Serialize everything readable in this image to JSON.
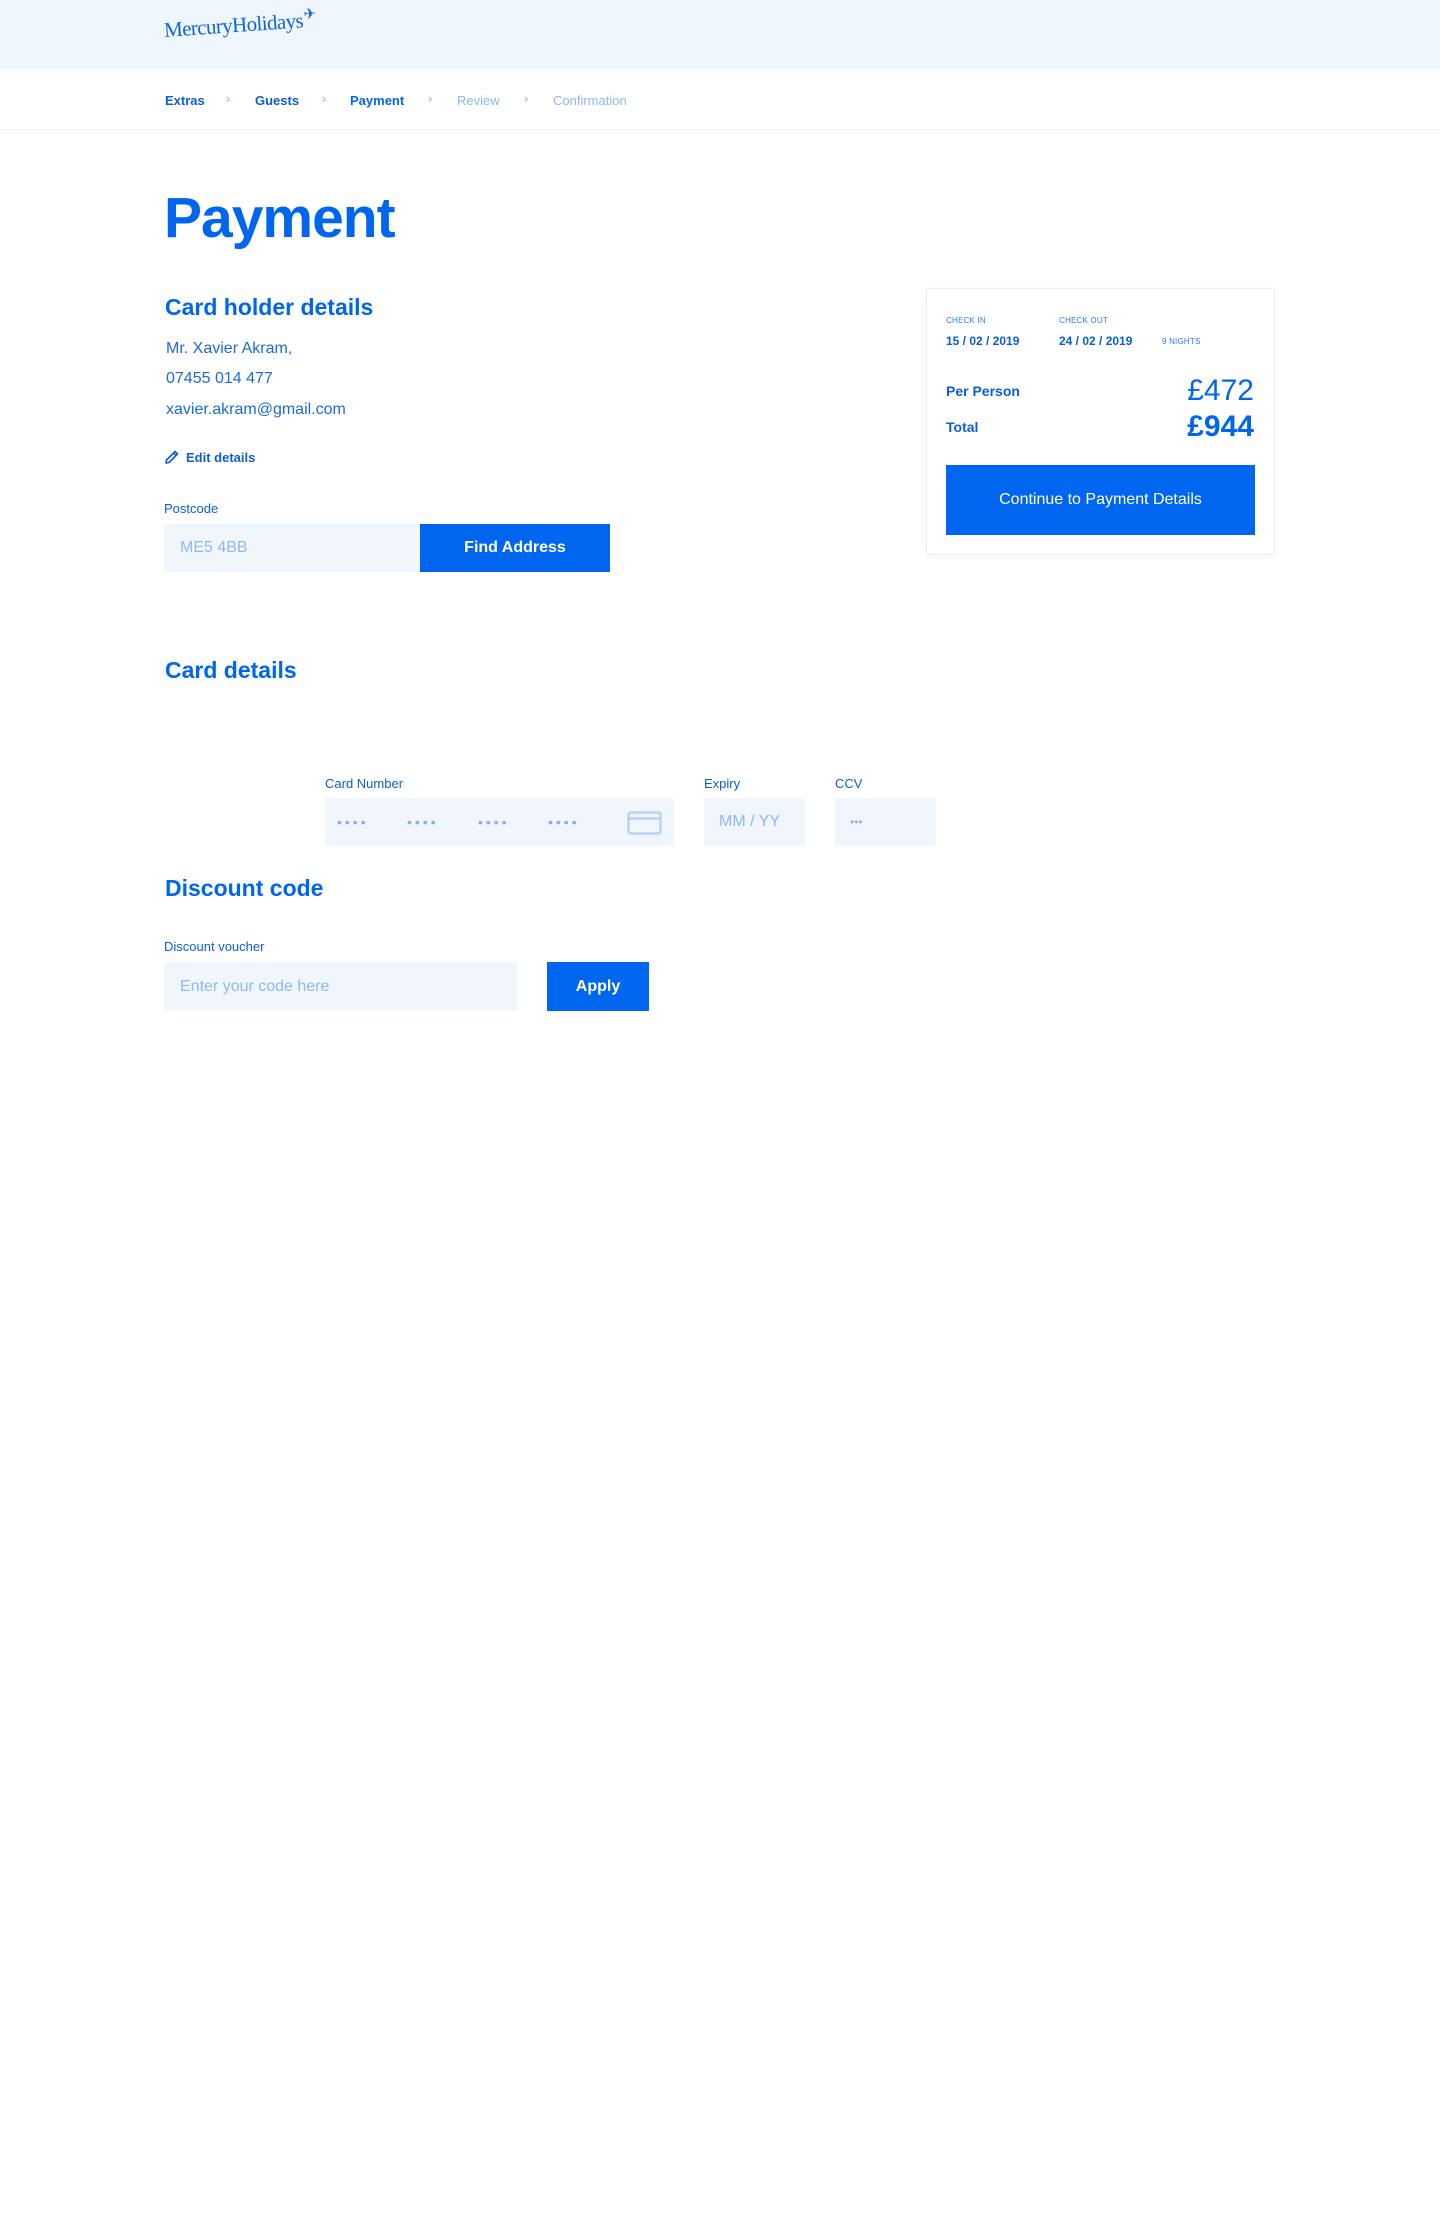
{
  "header": {
    "logo_text": "MercuryHolidays",
    "logo_icon": "plane-icon"
  },
  "breadcrumb": {
    "items": [
      {
        "label": "Extras",
        "state": "done"
      },
      {
        "label": "Guests",
        "state": "done"
      },
      {
        "label": "Payment",
        "state": "active"
      },
      {
        "label": "Review",
        "state": "todo"
      },
      {
        "label": "Confirmation",
        "state": "todo"
      }
    ],
    "separator": "›"
  },
  "page": {
    "title": "Payment"
  },
  "card_holder": {
    "heading": "Card holder details",
    "name": "Mr. Xavier Akram,",
    "phone": "07455 014 477",
    "email": "xavier.akram@gmail.com",
    "edit_label": "Edit details",
    "postcode_label": "Postcode",
    "postcode_value": "ME5 4BB",
    "find_address_label": "Find Address"
  },
  "summary": {
    "check_in_label": "CHECK IN",
    "check_in_date": "15 / 02 / 2019",
    "check_out_label": "CHECK OUT",
    "check_out_date": "24 / 02 / 2019",
    "nights": "9 NIGHTS",
    "per_person_label": "Per Person",
    "per_person_value": "£472",
    "total_label": "Total",
    "total_value": "£944",
    "continue_label": "Continue to Payment Details"
  },
  "card_details": {
    "heading": "Card details",
    "card_number_label": "Card Number",
    "card_number_groups": [
      "••••",
      "••••",
      "••••",
      "••••"
    ],
    "expiry_label": "Expiry",
    "expiry_placeholder": "MM / YY",
    "ccv_label": "CCV",
    "ccv_placeholder": "•••"
  },
  "discount": {
    "heading": "Discount code",
    "voucher_label": "Discount voucher",
    "voucher_placeholder": "Enter your code here",
    "apply_label": "Apply"
  },
  "colors": {
    "primary": "#0066f0",
    "header_bg": "#f0f6fe",
    "input_bg": "#f1f6fd",
    "muted": "#8eb7ee"
  }
}
